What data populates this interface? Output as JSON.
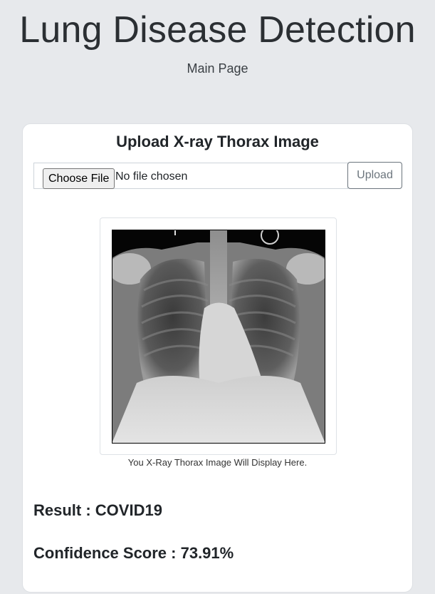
{
  "header": {
    "title": "Lung Disease Detection",
    "subtitle": "Main Page"
  },
  "upload_card": {
    "title": "Upload X-ray Thorax Image",
    "choose_file_label": "Choose File",
    "file_status": "No file chosen",
    "upload_label": "Upload",
    "image_caption": "You X-Ray Thorax Image Will Display Here.",
    "result_text": "Result : COVID19",
    "confidence_text": "Confidence Score : 73.91%"
  },
  "colors": {
    "page_background": "#e7e9ec",
    "card_background": "#ffffff",
    "upload_button_text": "#6c757d"
  },
  "icons": {
    "xray_image": "chest-xray-image"
  }
}
